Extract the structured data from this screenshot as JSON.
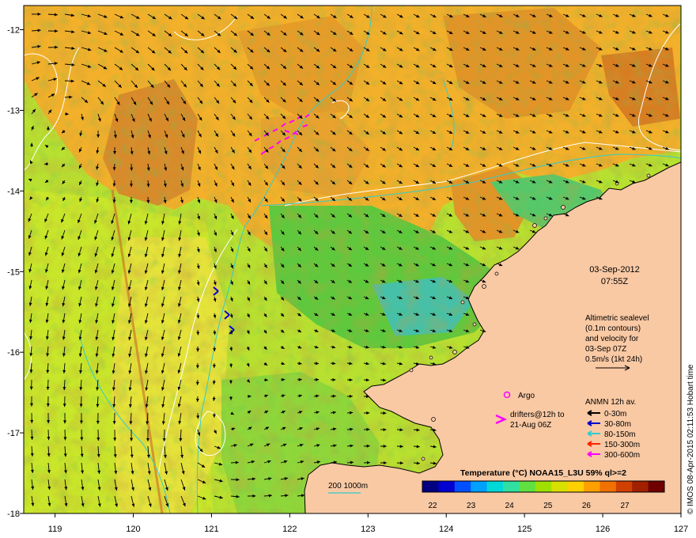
{
  "map": {
    "lon_ticks": [
      "119",
      "120",
      "121",
      "122",
      "123",
      "124",
      "125",
      "126",
      "127"
    ],
    "lat_ticks": [
      "-12",
      "-13",
      "-14",
      "-15",
      "-16",
      "-17",
      "-18"
    ],
    "lon_range": [
      118.6,
      127.0
    ],
    "lat_range": [
      -18.0,
      -11.7
    ],
    "colors": {
      "land": "#f9c9a4",
      "coast": "#000000",
      "contour": "#ffffff",
      "bathy": "#33cccc",
      "frame": "#000000"
    }
  },
  "info": {
    "date": "03-Sep-2012",
    "time": "07:55Z",
    "altimetry_lines": [
      "Altimetric sealevel",
      "(0.1m contours)",
      "and velocity for",
      "03-Sep 07Z",
      "0.5m/s (1kt 24h)"
    ]
  },
  "legend": {
    "argo_label": "Argo",
    "drifters_lines": [
      "drifters@12h to",
      "21-Aug 06Z"
    ],
    "anmn_title": "ANMN 12h av.",
    "depths": [
      {
        "label": "0-30m",
        "color": "#000000"
      },
      {
        "label": "30-80m",
        "color": "#0000cc"
      },
      {
        "label": "80-150m",
        "color": "#33cccc"
      },
      {
        "label": "150-300m",
        "color": "#ff2200"
      },
      {
        "label": "300-600m",
        "color": "#ff00ff"
      }
    ],
    "bathy_label": "200  1000m"
  },
  "colorbar": {
    "title": "Temperature (°C) NOAA15_L3U 59% ql>=2",
    "ticks": [
      "22",
      "23",
      "24",
      "25",
      "26",
      "27"
    ],
    "colors": [
      "#000080",
      "#0000d0",
      "#0050ff",
      "#00a0ff",
      "#00d8d8",
      "#30e0a0",
      "#60e040",
      "#a0e000",
      "#d8e000",
      "#ffd000",
      "#ffa000",
      "#f07000",
      "#d04000",
      "#a02000",
      "#700000"
    ]
  },
  "credit": "© IMOS 08-Apr-2015 02:11:53 Hobart time"
}
